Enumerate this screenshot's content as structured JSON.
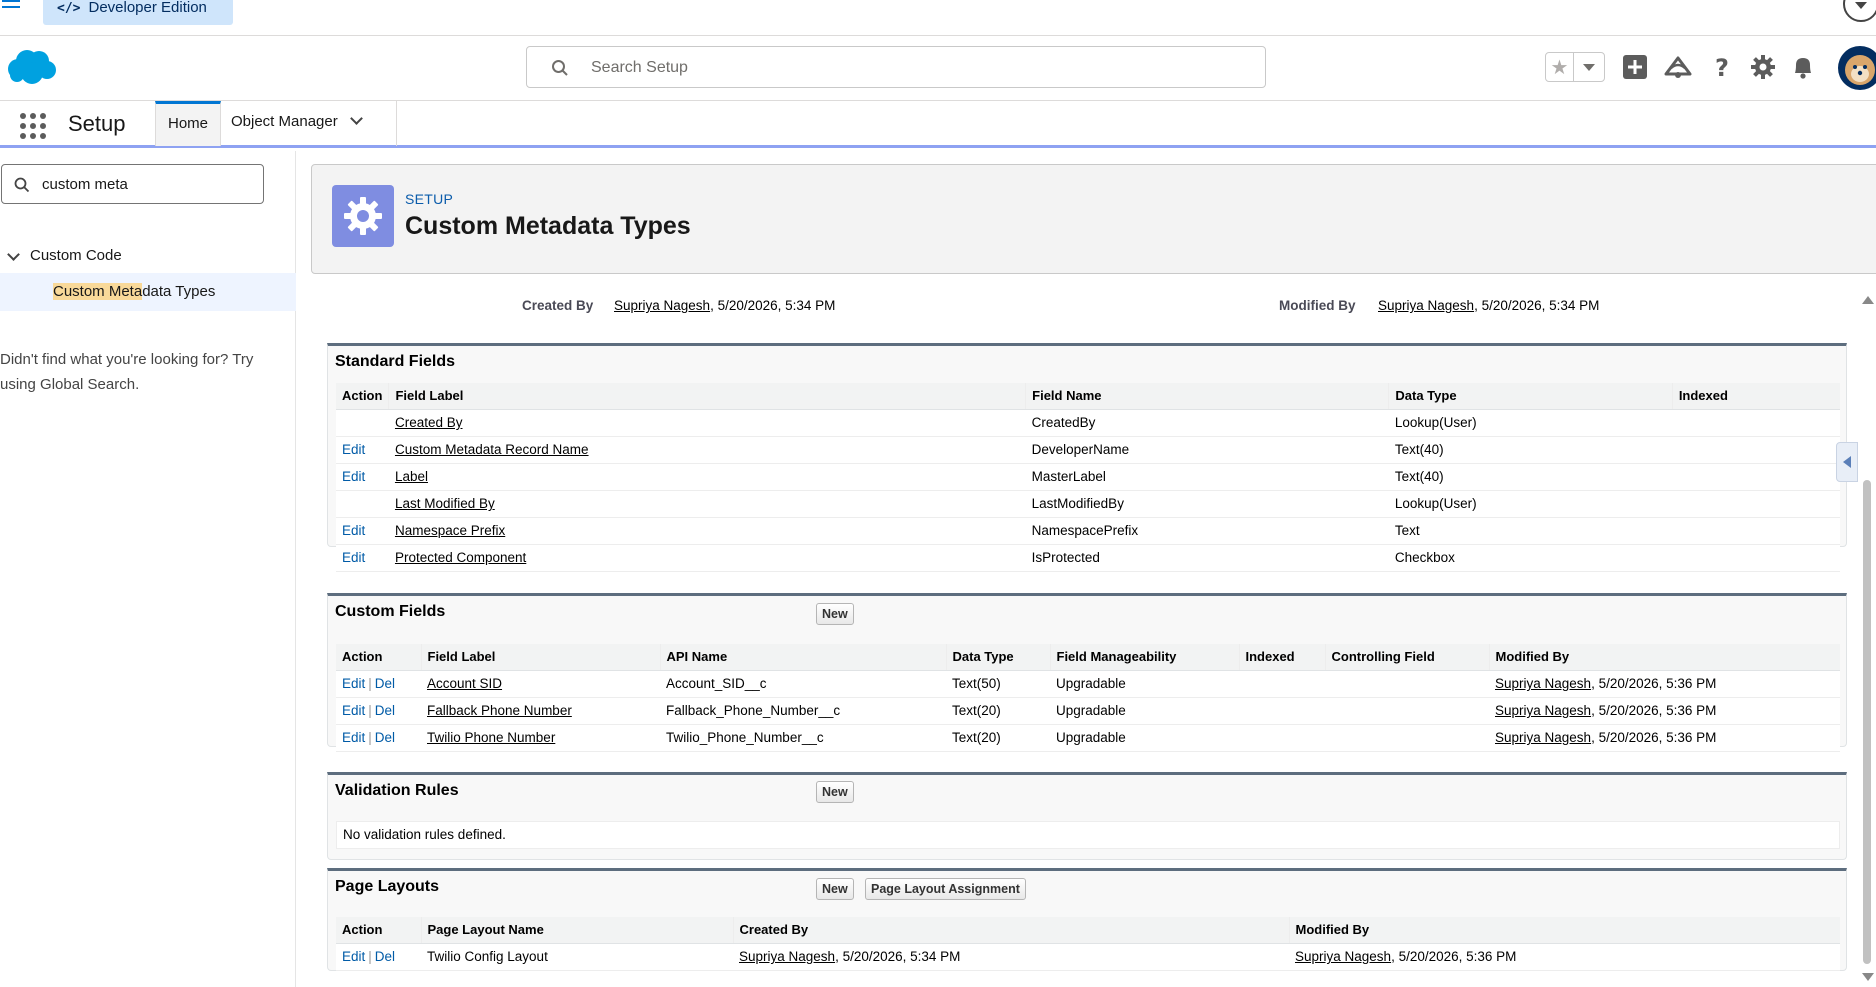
{
  "topstrip": {
    "edition_label": "Developer Edition"
  },
  "header": {
    "search_placeholder": "Search Setup"
  },
  "nav": {
    "app_name": "Setup",
    "tabs": [
      {
        "label": "Home"
      },
      {
        "label": "Object Manager"
      }
    ]
  },
  "sidebar": {
    "quickfind_value": "custom meta",
    "section_label": "Custom Code",
    "item": {
      "match": "Custom Meta",
      "rest": "data Types"
    },
    "notfound": "Didn't find what you're looking for? Try using Global Search."
  },
  "page_header": {
    "eyebrow": "SETUP",
    "title": "Custom Metadata Types"
  },
  "info": {
    "created_by_label": "Created By",
    "created_by_user": "Supriya Nagesh",
    "created_by_date": ", 5/20/2026, 5:34 PM",
    "modified_by_label": "Modified By",
    "modified_by_user": "Supriya Nagesh",
    "modified_by_date": ", 5/20/2026, 5:34 PM"
  },
  "standard_fields": {
    "title": "Standard Fields",
    "headers": [
      "Action",
      "Field Label",
      "Field Name",
      "Data Type",
      "Indexed"
    ],
    "rows": [
      {
        "action": "",
        "label": "Created By",
        "name": "CreatedBy",
        "type": "Lookup(User)"
      },
      {
        "action": "Edit",
        "label": "Custom Metadata Record Name",
        "name": "DeveloperName",
        "type": "Text(40)"
      },
      {
        "action": "Edit",
        "label": "Label",
        "name": "MasterLabel",
        "type": "Text(40)"
      },
      {
        "action": "",
        "label": "Last Modified By",
        "name": "LastModifiedBy",
        "type": "Lookup(User)"
      },
      {
        "action": "Edit",
        "label": "Namespace Prefix",
        "name": "NamespacePrefix",
        "type": "Text"
      },
      {
        "action": "Edit",
        "label": "Protected Component",
        "name": "IsProtected",
        "type": "Checkbox"
      }
    ]
  },
  "custom_fields": {
    "title": "Custom Fields",
    "new_label": "New",
    "edit_label": "Edit",
    "del_label": "Del",
    "separator": "|",
    "headers": [
      "Action",
      "Field Label",
      "API Name",
      "Data Type",
      "Field Manageability",
      "Indexed",
      "Controlling Field",
      "Modified By"
    ],
    "rows": [
      {
        "label": "Account SID",
        "api": "Account_SID__c",
        "type": "Text(50)",
        "manage": "Upgradable",
        "user": "Supriya Nagesh",
        "date": ", 5/20/2026, 5:36 PM"
      },
      {
        "label": "Fallback Phone Number",
        "api": "Fallback_Phone_Number__c",
        "type": "Text(20)",
        "manage": "Upgradable",
        "user": "Supriya Nagesh",
        "date": ", 5/20/2026, 5:36 PM"
      },
      {
        "label": "Twilio Phone Number",
        "api": "Twilio_Phone_Number__c",
        "type": "Text(20)",
        "manage": "Upgradable",
        "user": "Supriya Nagesh",
        "date": ", 5/20/2026, 5:36 PM"
      }
    ]
  },
  "validation_rules": {
    "title": "Validation Rules",
    "new_label": "New",
    "empty_text": "No validation rules defined."
  },
  "page_layouts": {
    "title": "Page Layouts",
    "new_label": "New",
    "assignment_label": "Page Layout Assignment",
    "edit_label": "Edit",
    "del_label": "Del",
    "separator": "|",
    "headers": [
      "Action",
      "Page Layout Name",
      "Created By",
      "Modified By"
    ],
    "rows": [
      {
        "name": "Twilio Config Layout",
        "created_user": "Supriya Nagesh",
        "created_date": ", 5/20/2026, 5:34 PM",
        "modified_user": "Supriya Nagesh",
        "modified_date": ", 5/20/2026, 5:36 PM"
      }
    ]
  },
  "colors": {
    "brand": "#0176d3",
    "setup_icon": "#7f8de1",
    "link": "#015ba7"
  }
}
